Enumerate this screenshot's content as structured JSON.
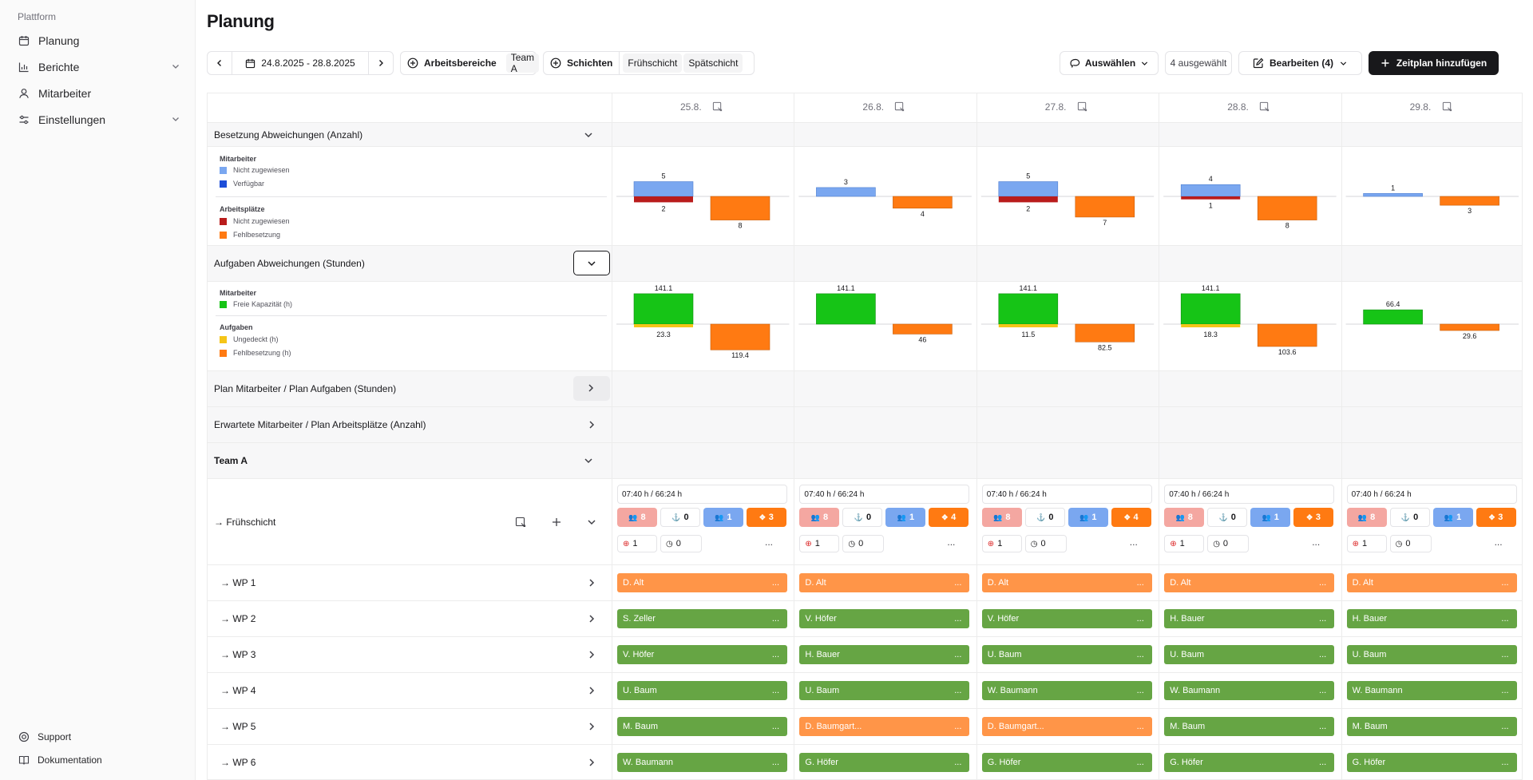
{
  "sidebar": {
    "section": "Plattform",
    "items": [
      {
        "label": "Planung",
        "icon": "calendar-icon"
      },
      {
        "label": "Berichte",
        "icon": "chart-icon"
      },
      {
        "label": "Mitarbeiter",
        "icon": "user-icon"
      },
      {
        "label": "Einstellungen",
        "icon": "sliders-icon"
      }
    ],
    "footer": [
      {
        "label": "Support",
        "icon": "lifebuoy-icon"
      },
      {
        "label": "Dokumentation",
        "icon": "book-icon"
      }
    ]
  },
  "page": {
    "title": "Planung"
  },
  "toolbar": {
    "date_range": "24.8.2025 - 28.8.2025",
    "arbeitsbereiche": "Arbeitsbereiche",
    "team": "Team A",
    "schichten": "Schichten",
    "shift1": "Frühschicht",
    "shift2": "Spätschicht",
    "auswaehlen": "Auswählen",
    "selected": "4 ausgewählt",
    "bearbeiten": "Bearbeiten (4)",
    "add": "Zeitplan hinzufügen"
  },
  "days": [
    "25.8.",
    "26.8.",
    "27.8.",
    "28.8.",
    "29.8."
  ],
  "sections": {
    "besetzung": "Besetzung Abweichungen (Anzahl)",
    "aufgaben": "Aufgaben Abweichungen (Stunden)",
    "plan_ma": "Plan Mitarbeiter / Plan Aufgaben (Stunden)",
    "erwartete": "Erwartete Mitarbeiter / Plan Arbeitsplätze (Anzahl)",
    "team": "Team A",
    "shift": "→ Frühschicht"
  },
  "legend1": {
    "h1": "Mitarbeiter",
    "a": "Nicht zugewiesen",
    "b": "Verfügbar",
    "h2": "Arbeitsplätze",
    "c": "Nicht zugewiesen",
    "d": "Fehlbesetzung"
  },
  "legend2": {
    "h1": "Mitarbeiter",
    "a": "Freie Kapazität (h)",
    "h2": "Aufgaben",
    "b": "Ungedeckt (h)",
    "c": "Fehlbesetzung (h)"
  },
  "colors": {
    "blue": "#7aa7f0",
    "darkblue": "#1d4ed8",
    "red": "#b91c1c",
    "orange": "#ff7a12",
    "green": "#16c416",
    "yellow": "#f5c518"
  },
  "chart_data": [
    {
      "type": "bar",
      "title": "Besetzung Abweichungen (Anzahl)",
      "categories": [
        "25.8.",
        "26.8.",
        "27.8.",
        "28.8.",
        "29.8."
      ],
      "series": [
        {
          "name": "Nicht zugewiesen",
          "values": [
            5,
            3,
            5,
            4,
            1
          ]
        },
        {
          "name": "Nicht zugewiesen",
          "values": [
            2,
            0,
            2,
            1,
            0
          ]
        },
        {
          "name": "Fehlbesetzung",
          "values": [
            8,
            4,
            7,
            8,
            3
          ]
        }
      ]
    },
    {
      "type": "bar",
      "title": "Aufgaben Abweichungen (Stunden)",
      "categories": [
        "25.8.",
        "26.8.",
        "27.8.",
        "28.8.",
        "29.8."
      ],
      "series": [
        {
          "name": "Freie Kapazität (h)",
          "values": [
            141.1,
            141.1,
            141.1,
            141.1,
            66.4
          ]
        },
        {
          "name": "Ungedeckt (h)",
          "values": [
            23.3,
            0,
            11.5,
            18.3,
            0
          ]
        },
        {
          "name": "Fehlbesetzung (h)",
          "values": [
            119.4,
            46,
            82.5,
            103.6,
            29.6
          ]
        }
      ]
    }
  ],
  "fruehschicht": {
    "hours": "07:40 h / 66:24 h",
    "stats": [
      [
        "8",
        "0",
        "1",
        "3"
      ],
      [
        "8",
        "0",
        "1",
        "4"
      ],
      [
        "8",
        "0",
        "1",
        "4"
      ],
      [
        "8",
        "0",
        "1",
        "3"
      ],
      [
        "8",
        "0",
        "1",
        "3"
      ]
    ],
    "alert": "1",
    "clock": "0",
    "more": "..."
  },
  "wps": [
    {
      "label": "→ WP 1",
      "cells": [
        [
          "D. Alt",
          "o"
        ],
        [
          "D. Alt",
          "o"
        ],
        [
          "D. Alt",
          "o"
        ],
        [
          "D. Alt",
          "o"
        ],
        [
          "D. Alt",
          "o"
        ]
      ]
    },
    {
      "label": "→ WP 2",
      "cells": [
        [
          "S. Zeller",
          "g"
        ],
        [
          "V. Höfer",
          "g"
        ],
        [
          "V. Höfer",
          "g"
        ],
        [
          "H. Bauer",
          "g"
        ],
        [
          "H. Bauer",
          "g"
        ]
      ]
    },
    {
      "label": "→ WP 3",
      "cells": [
        [
          "V. Höfer",
          "g"
        ],
        [
          "H. Bauer",
          "g"
        ],
        [
          "U. Baum",
          "g"
        ],
        [
          "U. Baum",
          "g"
        ],
        [
          "U. Baum",
          "g"
        ]
      ]
    },
    {
      "label": "→ WP 4",
      "cells": [
        [
          "U. Baum",
          "g"
        ],
        [
          "U. Baum",
          "g"
        ],
        [
          "W. Baumann",
          "g"
        ],
        [
          "W. Baumann",
          "g"
        ],
        [
          "W. Baumann",
          "g"
        ]
      ]
    },
    {
      "label": "→ WP 5",
      "cells": [
        [
          "M. Baum",
          "g"
        ],
        [
          "D. Baumgart...",
          "o"
        ],
        [
          "D. Baumgart...",
          "o"
        ],
        [
          "M. Baum",
          "g"
        ],
        [
          "M. Baum",
          "g"
        ]
      ]
    },
    {
      "label": "→ WP 6",
      "cells": [
        [
          "W. Baumann",
          "g"
        ],
        [
          "G. Höfer",
          "g"
        ],
        [
          "G. Höfer",
          "g"
        ],
        [
          "G. Höfer",
          "g"
        ],
        [
          "G. Höfer",
          "g"
        ]
      ]
    }
  ]
}
